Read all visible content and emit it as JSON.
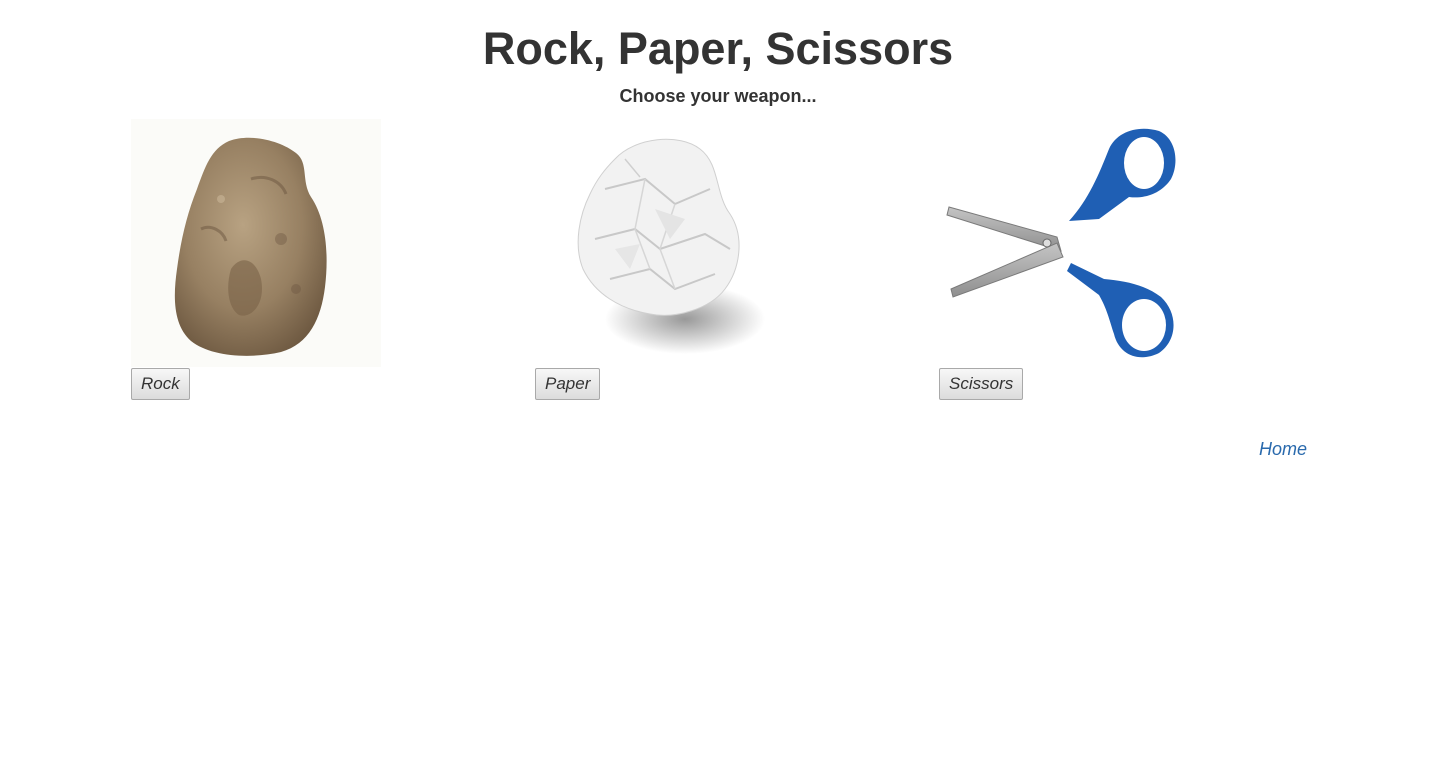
{
  "header": {
    "title": "Rock, Paper, Scissors",
    "subtitle": "Choose your weapon..."
  },
  "weapons": [
    {
      "id": "rock",
      "label": "Rock",
      "icon": "rock-image"
    },
    {
      "id": "paper",
      "label": "Paper",
      "icon": "crumpled-paper-image"
    },
    {
      "id": "scissors",
      "label": "Scissors",
      "icon": "scissors-image"
    }
  ],
  "footer": {
    "home_label": "Home"
  },
  "colors": {
    "text": "#333333",
    "link": "#2a6aad",
    "scissors_handle": "#1f5fb4",
    "rock": "#9a8466"
  }
}
